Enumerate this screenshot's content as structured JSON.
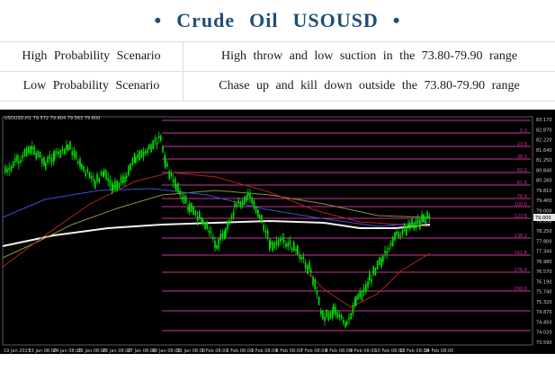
{
  "header": {
    "bullet": "•",
    "title_words": [
      "Crude",
      "Oil",
      "USOUSD"
    ]
  },
  "scenarios": [
    {
      "label": "High Probability Scenario",
      "description": "High throw and low suction in the 73.80-79.90 range"
    },
    {
      "label": "Low Probability Scenario",
      "description": "Chase up and kill down outside the 73.80-79.90 range"
    }
  ],
  "chart": {
    "symbol_header": "USOUSD,H1  79.572 79.604 79.563 79.600",
    "current_price": "79.000",
    "price_axis": [
      "83.170",
      "82.870",
      "82.220",
      "81.640",
      "81.250",
      "80.840",
      "80.260",
      "79.810",
      "79.400",
      "79.000",
      "78.590",
      "78.250",
      "77.800",
      "77.340",
      "76.980",
      "76.570",
      "76.190",
      "75.740",
      "75.320",
      "74.870",
      "74.450",
      "74.020",
      "73.590"
    ],
    "time_axis": [
      "19 Jan 2023",
      "23 Jan 08:00",
      "24 Jan 08:00",
      "25 Jan 08:00",
      "26 Jan 08:00",
      "27 Jan 08:00",
      "30 Jan 08:00",
      "31 Jan 08:00",
      "1 Feb 08:00",
      "2 Feb 08:00",
      "3 Feb 08:00",
      "6 Feb 08:00",
      "7 Feb 08:00",
      "8 Feb 08:00",
      "9 Feb 08:00",
      "10 Feb 08:00",
      "13 Feb 08:00",
      "14 Feb 08:00"
    ],
    "fib_labels": [
      "0.0",
      "23.6",
      "38.2",
      "50.0",
      "61.8",
      "76.4",
      "100.0",
      "123.6",
      "138.2",
      "161.8",
      "176.4",
      "200.0"
    ],
    "colors": {
      "background": "#000000",
      "candles": "#00e000",
      "fib_lines": "#cc3399",
      "ma_white": "#f2f2f2",
      "ma_red": "#b22222",
      "ma_olive": "#8f8f3f",
      "ma_blue": "#3b4fd6"
    }
  }
}
